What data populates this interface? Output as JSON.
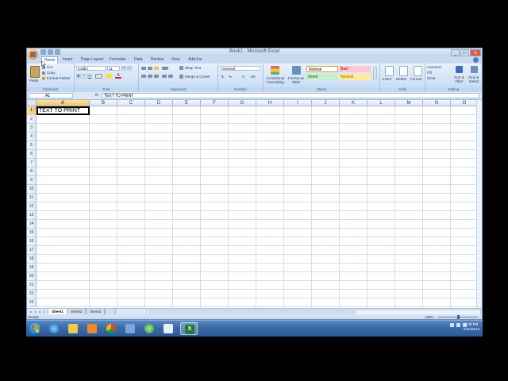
{
  "window": {
    "title": "Book1 - Microsoft Excel"
  },
  "tabs": [
    "Home",
    "Insert",
    "Page Layout",
    "Formulas",
    "Data",
    "Review",
    "View",
    "Add-Ins"
  ],
  "active_tab": "Home",
  "ribbon": {
    "clipboard": {
      "label": "Clipboard",
      "paste": "Paste",
      "cut": "Cut",
      "copy": "Copy",
      "format_painter": "Format Painter"
    },
    "font": {
      "label": "Font",
      "font_name": "Calibri",
      "font_size": "11",
      "bold": "B",
      "italic": "I",
      "underline": "U",
      "grow": "A",
      "shrink": "A"
    },
    "alignment": {
      "label": "Alignment",
      "wrap_text": "Wrap Text",
      "merge_center": "Merge & Center"
    },
    "number": {
      "label": "Number",
      "format": "General",
      "currency": "$",
      "percent": "%",
      "comma": ",",
      "inc_dec": ".0",
      "dec_dec": ".00"
    },
    "styles": {
      "label": "Styles",
      "conditional": "Conditional Formatting",
      "format_table": "Format as Table",
      "normal": "Normal",
      "bad": "Bad",
      "good": "Good",
      "neutral": "Neutral"
    },
    "cells": {
      "label": "Cells",
      "insert": "Insert",
      "delete": "Delete",
      "format": "Format"
    },
    "editing": {
      "label": "Editing",
      "autosum": "AutoSum",
      "fill": "Fill",
      "clear": "Clear",
      "sort_filter": "Sort & Filter",
      "find_select": "Find & Select"
    }
  },
  "formula_bar": {
    "name_box": "A1",
    "fx": "fx",
    "content": "TEXT TO PRINT"
  },
  "columns": [
    "A",
    "B",
    "C",
    "D",
    "E",
    "F",
    "G",
    "H",
    "I",
    "J",
    "K",
    "L",
    "M",
    "N",
    "O"
  ],
  "rows": [
    "1",
    "2",
    "3",
    "4",
    "5",
    "6",
    "7",
    "8",
    "9",
    "10",
    "11",
    "12",
    "13",
    "14",
    "15",
    "16",
    "17",
    "18",
    "19",
    "20",
    "21",
    "22",
    "23"
  ],
  "cell_a1": "TEXT TO PRINT",
  "sheets": [
    "Sheet1",
    "Sheet2",
    "Sheet3"
  ],
  "active_sheet": "Sheet1",
  "status": {
    "ready": "Ready",
    "zoom": "130%"
  },
  "taskbar": {
    "icons": [
      "explorer-ie-icon",
      "folder-icon",
      "media-player-icon",
      "chrome-icon",
      "windows-explorer-icon",
      "ie-icon",
      "unknown-app-icon",
      "excel-icon"
    ],
    "clock_time": "4:39 PM",
    "clock_date": "5/30/2013"
  },
  "colors": {
    "ribbon": "#dbe7f6",
    "selected_header": "#f5c56b",
    "taskbar": "#3b6aa8",
    "excel_green": "#1f7a3a"
  }
}
